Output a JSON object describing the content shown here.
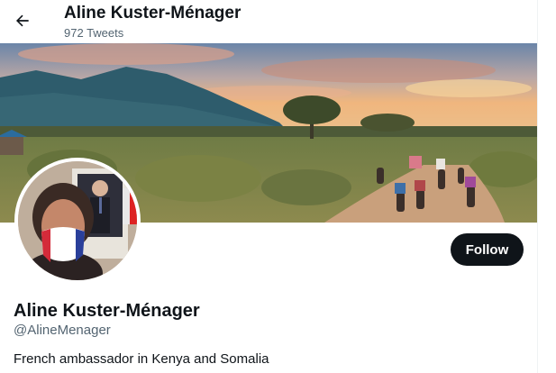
{
  "header": {
    "back_icon": "arrow-left-icon",
    "title": "Aline Kuster-Ménager",
    "tweet_count": "972 Tweets"
  },
  "banner": {
    "description_colors": {
      "sky_top": "#6a8ab0",
      "sunset": "#f2b27a",
      "mountain": "#2d5a6b",
      "savanna": "#7a8a4a",
      "path": "#c99a72"
    }
  },
  "profile": {
    "display_name": "Aline Kuster-Ménager",
    "handle": "@AlineMenager",
    "bio": "French ambassador in Kenya and Somalia",
    "follow_label": "Follow"
  },
  "colors": {
    "text_primary": "#0f1419",
    "text_secondary": "#536471",
    "button_bg": "#0f1419",
    "button_text": "#ffffff"
  }
}
